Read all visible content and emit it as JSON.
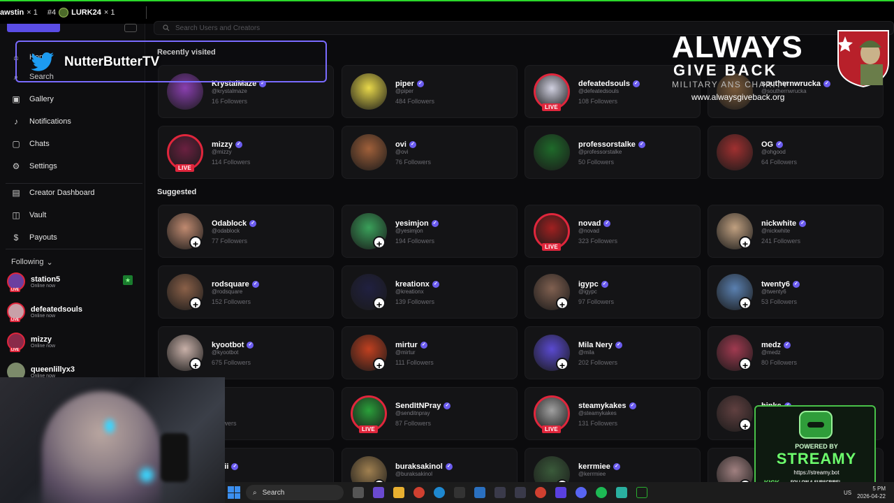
{
  "topbar": {
    "items": [
      {
        "rank": "",
        "name": "awstin",
        "count": "× 1"
      },
      {
        "rank": "#4",
        "name": "LURK24",
        "count": "× 1"
      }
    ]
  },
  "sidebar": {
    "nav": [
      {
        "label": "Home",
        "icon": "home-icon"
      },
      {
        "label": "Search",
        "icon": "search-icon"
      },
      {
        "label": "Gallery",
        "icon": "gallery-icon"
      },
      {
        "label": "Notifications",
        "icon": "bell-icon"
      },
      {
        "label": "Chats",
        "icon": "chat-icon"
      },
      {
        "label": "Settings",
        "icon": "gear-icon"
      },
      {
        "label": "Creator Dashboard",
        "icon": "dashboard-icon"
      },
      {
        "label": "Vault",
        "icon": "vault-icon"
      },
      {
        "label": "Payouts",
        "icon": "dollar-icon"
      }
    ],
    "following_label": "Following",
    "following": [
      {
        "name": "station5",
        "status": "Online now",
        "live": "LIVE",
        "color": "#6b3fa0"
      },
      {
        "name": "defeatedsouls",
        "status": "Online now",
        "live": "LIVE",
        "color": "#c8a0a8"
      },
      {
        "name": "mizzy",
        "status": "Online now",
        "live": "LIVE",
        "color": "#8a2a4a"
      },
      {
        "name": "queenlillyx3",
        "status": "Online now",
        "live": "",
        "color": "#7c8a6a"
      }
    ]
  },
  "search": {
    "placeholder": "Search Users and Creators"
  },
  "recent_title": "Recently visited",
  "suggested_title": "Suggested",
  "recent": [
    {
      "name": "KrystalMaze",
      "handle": "@krystalmaze",
      "followers": "16 Followers",
      "color": "#8a3fb0",
      "live": false
    },
    {
      "name": "piper",
      "handle": "@piper",
      "followers": "484 Followers",
      "color": "#e8d84a",
      "live": false
    },
    {
      "name": "defeatedsouls",
      "handle": "@defeatedsouls",
      "followers": "108 Followers",
      "color": "#d0d0e0",
      "live": true
    },
    {
      "name": "southernwrucka",
      "handle": "@southernwrucka",
      "followers": "",
      "color": "#7a5a3a",
      "live": false
    },
    {
      "name": "mizzy",
      "handle": "@mizzy",
      "followers": "114 Followers",
      "color": "#6a2040",
      "live": true
    },
    {
      "name": "ovi",
      "handle": "@ovi",
      "followers": "76 Followers",
      "color": "#a0603a",
      "live": false
    },
    {
      "name": "professorstalke",
      "handle": "@professorstalke",
      "followers": "50 Followers",
      "color": "#1f6a2a",
      "live": false
    },
    {
      "name": "OG",
      "handle": "@ohgood",
      "followers": "64 Followers",
      "color": "#a03030",
      "live": false
    }
  ],
  "suggested": [
    {
      "name": "Odablock",
      "handle": "@odablock",
      "followers": "77 Followers",
      "color": "#c08a70",
      "live": false
    },
    {
      "name": "yesimjon",
      "handle": "@yesimjon",
      "followers": "194 Followers",
      "color": "#3aa05a",
      "live": false
    },
    {
      "name": "novad",
      "handle": "@novad",
      "followers": "323 Followers",
      "color": "#a02020",
      "live": true
    },
    {
      "name": "nickwhite",
      "handle": "@nickwhite",
      "followers": "241 Followers",
      "color": "#c0a080",
      "live": false
    },
    {
      "name": "rodsquare",
      "handle": "@rodsquare",
      "followers": "152 Followers",
      "color": "#8a6048",
      "live": false
    },
    {
      "name": "kreationx",
      "handle": "@kreationx",
      "followers": "139 Followers",
      "color": "#202040",
      "live": false
    },
    {
      "name": "igypc",
      "handle": "@igypc",
      "followers": "97 Followers",
      "color": "#806050",
      "live": false
    },
    {
      "name": "twenty6",
      "handle": "@twenty6",
      "followers": "53 Followers",
      "color": "#5a80b0",
      "live": false
    },
    {
      "name": "kyootbot",
      "handle": "@kyootbot",
      "followers": "675 Followers",
      "color": "#c8b0a8",
      "live": false
    },
    {
      "name": "mirtur",
      "handle": "@mirtur",
      "followers": "111 Followers",
      "color": "#c04020",
      "live": false
    },
    {
      "name": "Mila Nery",
      "handle": "@mila",
      "followers": "202 Followers",
      "color": "#5a4ad0",
      "live": false
    },
    {
      "name": "medz",
      "handle": "@medz",
      "followers": "80 Followers",
      "color": "#a03a50",
      "live": false
    },
    {
      "name": "",
      "handle": "",
      "followers": "followers",
      "color": "#333",
      "live": false
    },
    {
      "name": "SendItNPray",
      "handle": "@senditnpray",
      "followers": "87 Followers",
      "color": "#2aa03a",
      "live": true
    },
    {
      "name": "steamykakes",
      "handle": "@steamykakes",
      "followers": "131 Followers",
      "color": "#a0a0a0",
      "live": true
    },
    {
      "name": "binks",
      "handle": "",
      "followers": "",
      "color": "#604040",
      "live": false
    },
    {
      "name": "liavii",
      "handle": "liavii",
      "followers": "",
      "color": "#333",
      "live": false
    },
    {
      "name": "buraksakinol",
      "handle": "@buraksakinol",
      "followers": "",
      "color": "#a08050",
      "live": false
    },
    {
      "name": "kerrmiee",
      "handle": "@kerrmiee",
      "followers": "",
      "color": "#3a5a3a",
      "live": false
    },
    {
      "name": "",
      "handle": "",
      "followers": "",
      "color": "#a08080",
      "live": false
    }
  ],
  "live_label": "LIVE",
  "overlay": {
    "twitter_name": "NutterButterTV",
    "agb_line1": "ALWAYS",
    "agb_line2": "GIVE BACK",
    "agb_line3": "MILITARY  ANS  CHARITY",
    "agb_url": "www.alwaysgiveback.org",
    "streamy_powered": "POWERED BY",
    "streamy_brand": "STREAMY",
    "streamy_url": "https://streamy.bot",
    "streamy_kick": "KICK",
    "streamy_follow": "FOLLOW & SUBSCRIBE!"
  },
  "taskbar": {
    "search": "Search",
    "lang": "US",
    "date": "2026-04-22",
    "time": "5 PM"
  }
}
